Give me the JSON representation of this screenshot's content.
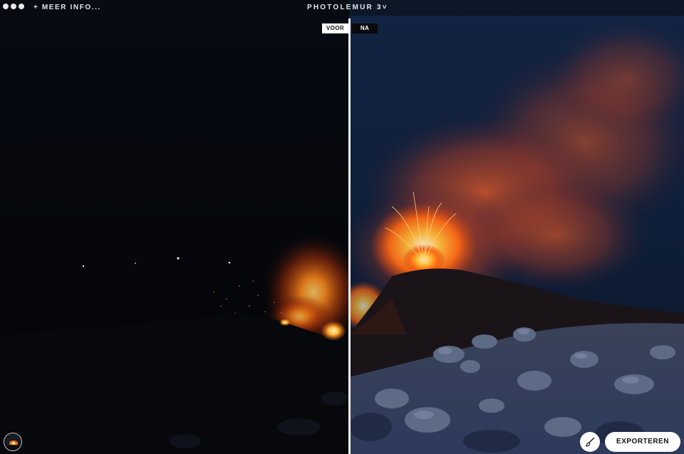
{
  "window": {
    "menu_more_info": "+ MEER INFO...",
    "app_title": "PHOTOLEMUR 3",
    "title_chevron": "˅"
  },
  "compare": {
    "before_label": "VOOR",
    "after_label": "NA"
  },
  "footer": {
    "export_label": "EXPORTEREN",
    "brush_icon": "brush-icon",
    "thumbnail_icon": "image-thumbnail"
  },
  "colors": {
    "accent_white": "#ffffff",
    "lava_orange": "#ff7a1a",
    "night_blue": "#0c1c33"
  }
}
